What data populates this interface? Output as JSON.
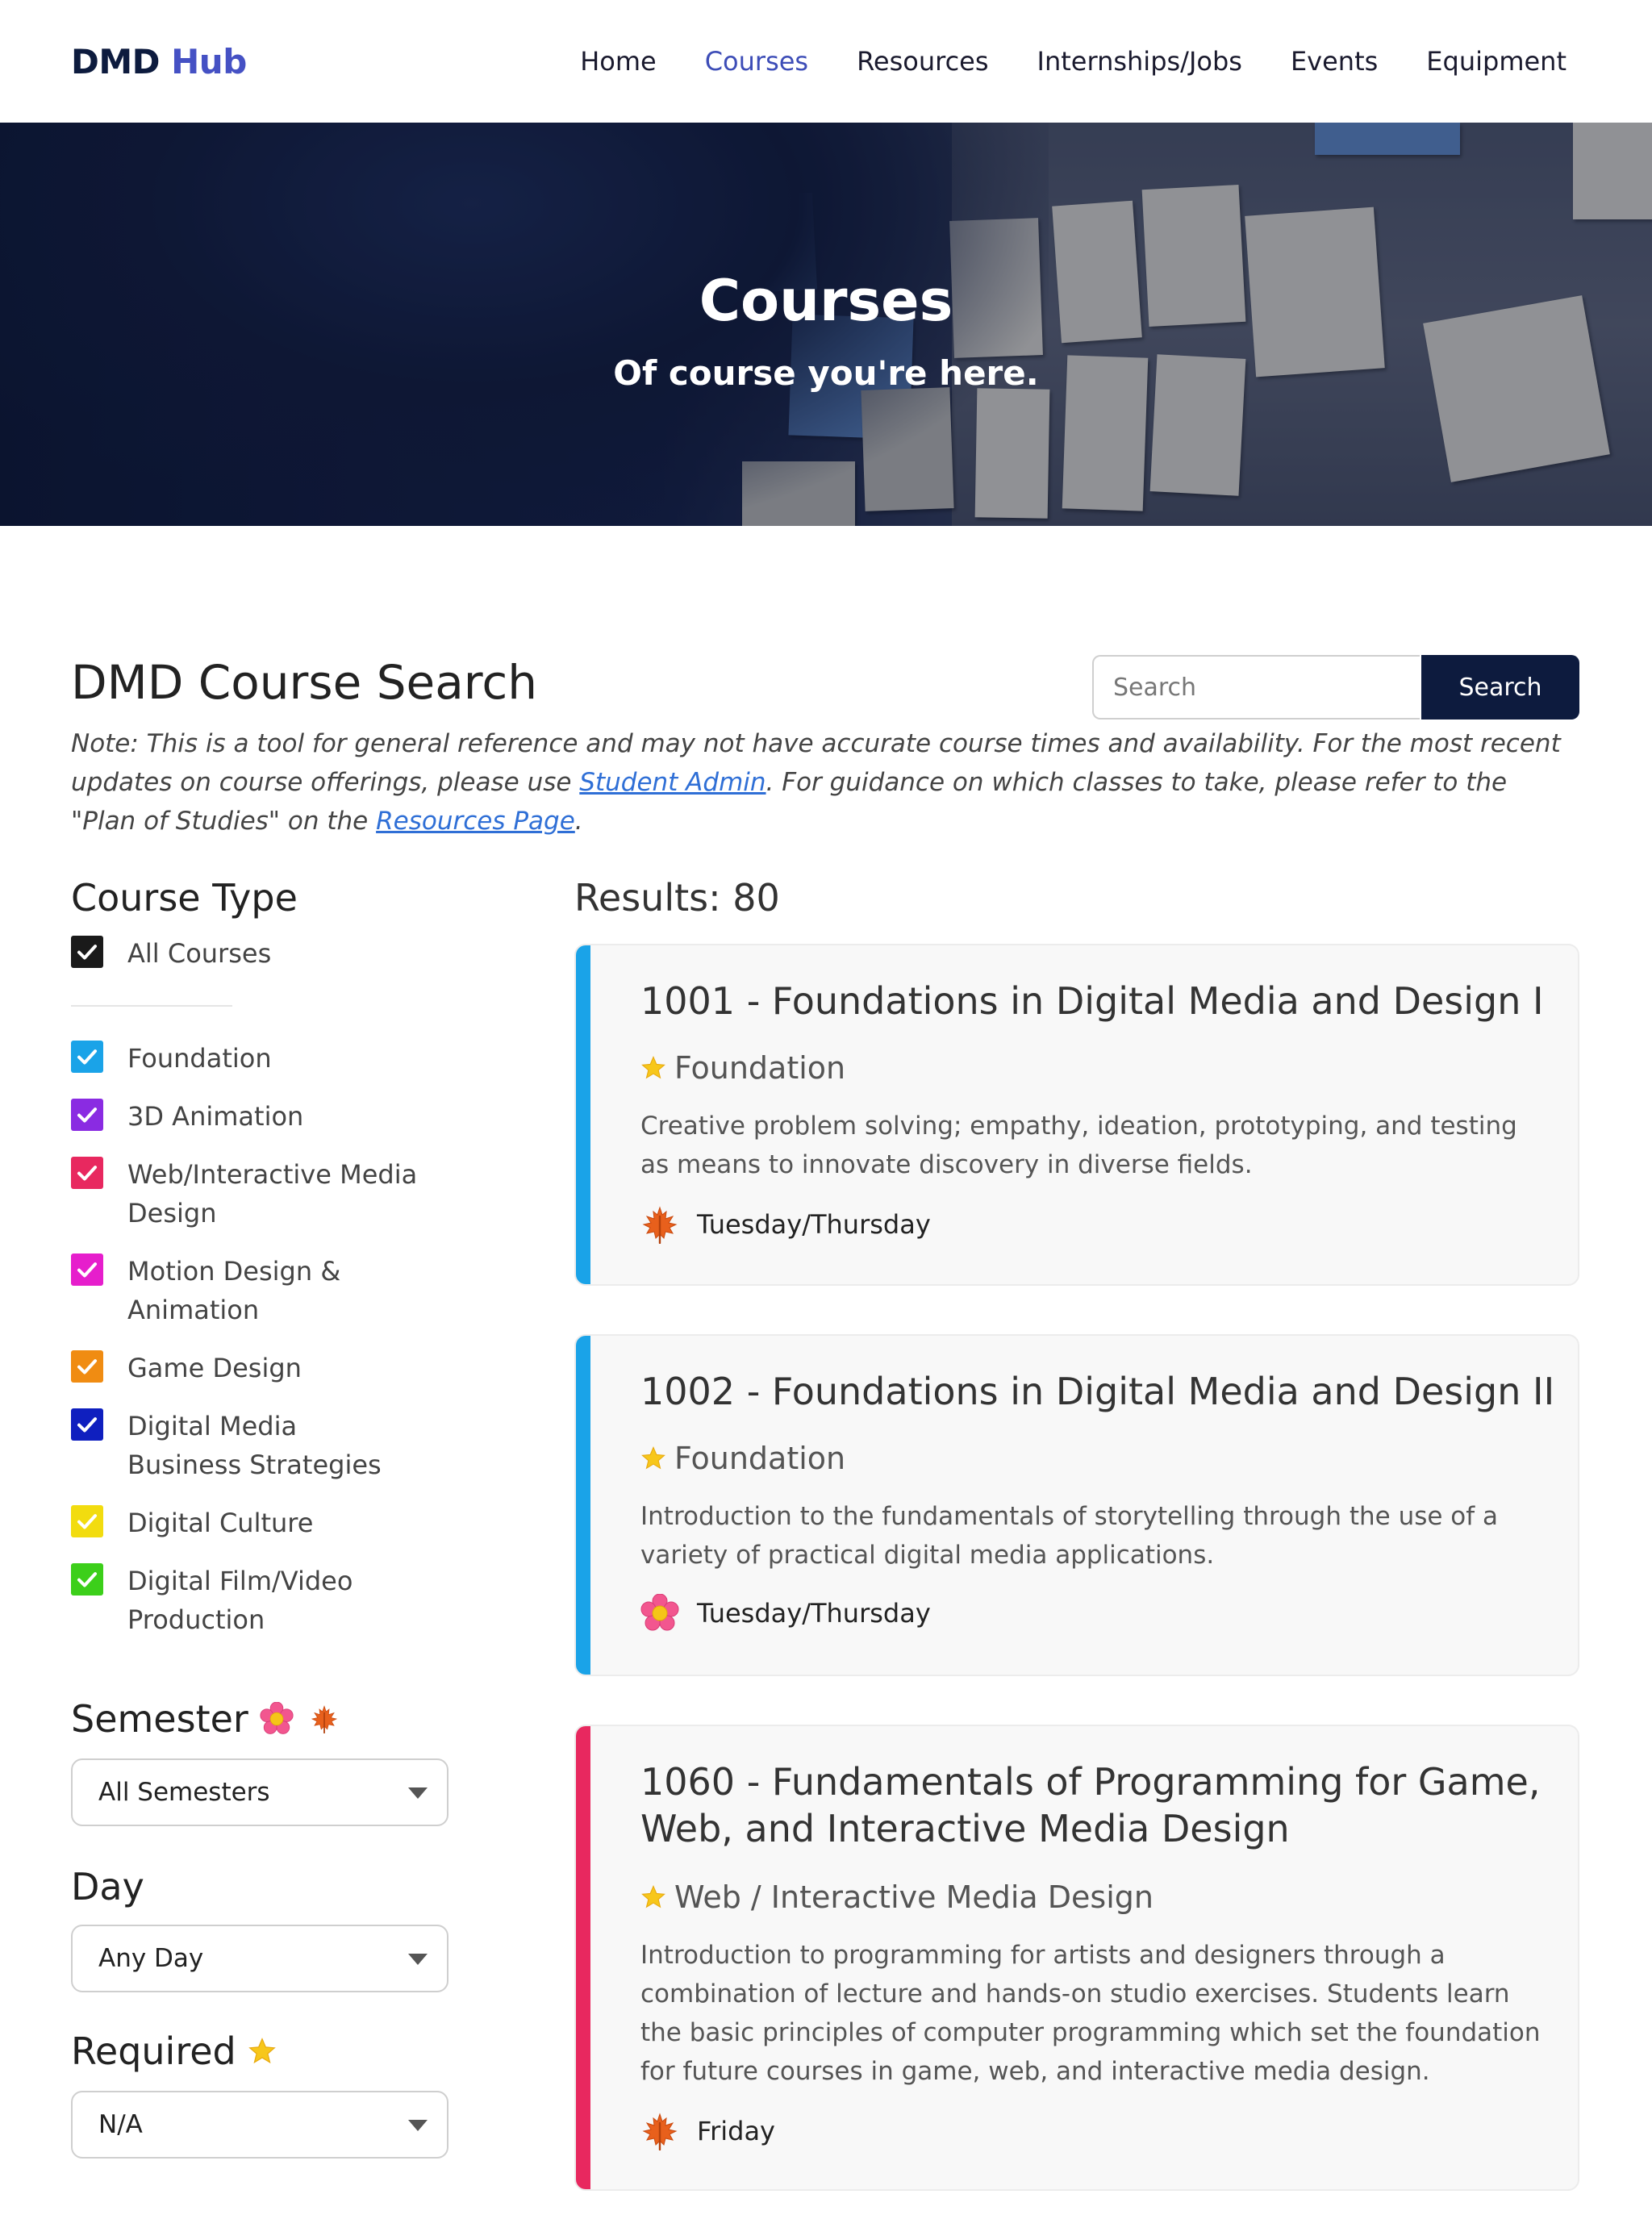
{
  "nav": {
    "logo_main": "DMD",
    "logo_accent": "Hub",
    "links": [
      {
        "label": "Home",
        "active": false
      },
      {
        "label": "Courses",
        "active": true
      },
      {
        "label": "Resources",
        "active": false
      },
      {
        "label": "Internships/Jobs",
        "active": false
      },
      {
        "label": "Events",
        "active": false
      },
      {
        "label": "Equipment",
        "active": false
      }
    ]
  },
  "hero": {
    "title": "Courses",
    "subtitle": "Of course you're here."
  },
  "search": {
    "title": "DMD Course Search",
    "placeholder": "Search",
    "button_label": "Search",
    "note_part1": "Note: This is a tool for general reference and may not have accurate course times and availability. For the most recent updates on course offerings, please use ",
    "note_link1": "Student Admin",
    "note_part2": ". For guidance on which classes to take, please refer to the \"Plan of Studies\" on the ",
    "note_link2": "Resources Page",
    "note_part3": "."
  },
  "sidebar": {
    "course_type_heading": "Course Type",
    "all_courses": {
      "label": "All Courses",
      "color": "#1a1a1a",
      "checked": true
    },
    "types": [
      {
        "label": "Foundation",
        "color": "#1aa3e8",
        "checked": true
      },
      {
        "label": "3D Animation",
        "color": "#8a2be2",
        "checked": true
      },
      {
        "label": "Web/Interactive Media Design",
        "color": "#e8285f",
        "checked": true
      },
      {
        "label": "Motion Design & Animation",
        "color": "#e61ecc",
        "checked": true
      },
      {
        "label": "Game Design",
        "color": "#f08c12",
        "checked": true
      },
      {
        "label": "Digital Media Business Strategies",
        "color": "#0f1fbf",
        "checked": true
      },
      {
        "label": "Digital Culture",
        "color": "#f2dc0f",
        "checked": true
      },
      {
        "label": "Digital Film/Video Production",
        "color": "#3ccf1a",
        "checked": true
      }
    ],
    "semester_heading": "Semester",
    "semester_value": "All Semesters",
    "day_heading": "Day",
    "day_value": "Any Day",
    "required_heading": "Required",
    "required_value": "N/A"
  },
  "results": {
    "heading": "Results: 80",
    "courses": [
      {
        "title": "1001 - Foundations in Digital Media and Design I",
        "type": "Foundation",
        "color": "#1aa3e8",
        "required": true,
        "description": "Creative problem solving; empathy, ideation, prototyping, and testing as means to innovate discovery in diverse fields.",
        "semester_icon": "maple-leaf-icon",
        "days": "Tuesday/Thursday"
      },
      {
        "title": "1002 - Foundations in Digital Media and Design II",
        "type": "Foundation",
        "color": "#1aa3e8",
        "required": true,
        "description": "Introduction to the fundamentals of storytelling through the use of a variety of practical digital media applications.",
        "semester_icon": "flower-icon",
        "days": "Tuesday/Thursday"
      },
      {
        "title": "1060 - Fundamentals of Programming for Game, Web, and Interactive Media Design",
        "type": "Web / Interactive Media Design",
        "color": "#e8285f",
        "required": true,
        "description": "Introduction to programming for artists and designers through a combination of lecture and hands-on studio exercises. Students learn the basic principles of computer programming which set the foundation for future courses in game, web, and interactive media design.",
        "semester_icon": "maple-leaf-icon",
        "days": "Friday"
      }
    ]
  }
}
